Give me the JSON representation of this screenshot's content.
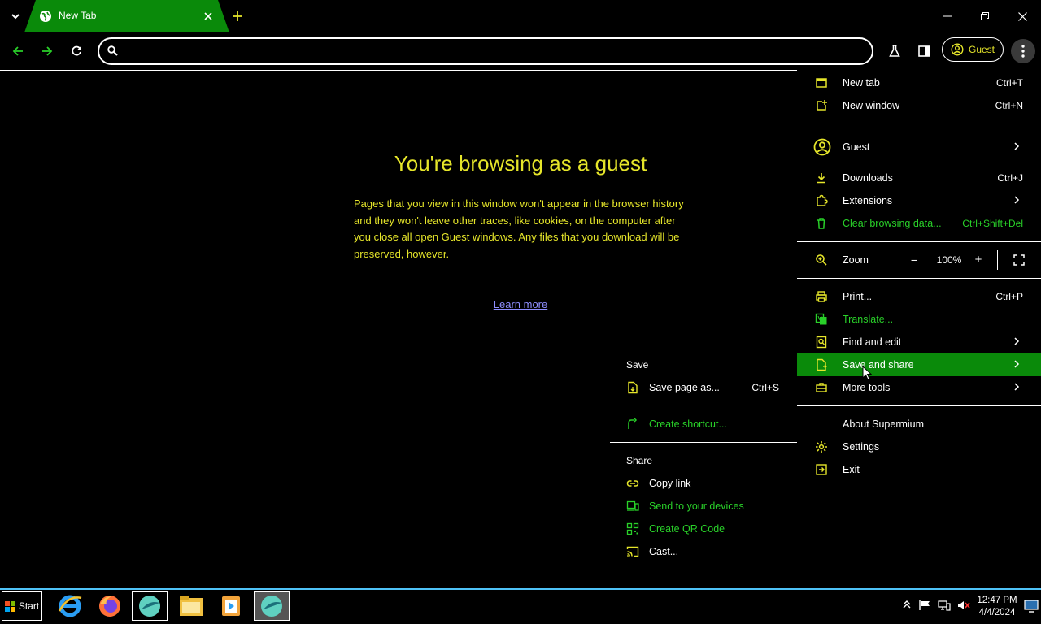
{
  "browser": {
    "tab_title": "New Tab",
    "guest_label": "Guest",
    "omnibox_value": ""
  },
  "page": {
    "title": "You're browsing as a guest",
    "body": "Pages that you view in this window won't appear in the browser history and they won't leave other traces, like cookies, on the computer after you close all open Guest windows. Any files that you download will be preserved, however.",
    "learn_more": "Learn more"
  },
  "menu": {
    "new_tab": {
      "label": "New tab",
      "shortcut": "Ctrl+T"
    },
    "new_window": {
      "label": "New window",
      "shortcut": "Ctrl+N"
    },
    "guest": {
      "label": "Guest"
    },
    "downloads": {
      "label": "Downloads",
      "shortcut": "Ctrl+J"
    },
    "extensions": {
      "label": "Extensions"
    },
    "clear_data": {
      "label": "Clear browsing data...",
      "shortcut": "Ctrl+Shift+Del"
    },
    "zoom": {
      "label": "Zoom",
      "minus": "−",
      "value": "100%",
      "plus": "+"
    },
    "print": {
      "label": "Print...",
      "shortcut": "Ctrl+P"
    },
    "translate": {
      "label": "Translate..."
    },
    "find_edit": {
      "label": "Find and edit"
    },
    "save_share": {
      "label": "Save and share"
    },
    "more_tools": {
      "label": "More tools"
    },
    "about": {
      "label": "About Supermium"
    },
    "settings": {
      "label": "Settings"
    },
    "exit": {
      "label": "Exit"
    }
  },
  "submenu": {
    "save_header": "Save",
    "save_page": {
      "label": "Save page as...",
      "shortcut": "Ctrl+S"
    },
    "create_shortcut": {
      "label": "Create shortcut..."
    },
    "share_header": "Share",
    "copy_link": {
      "label": "Copy link"
    },
    "send_devices": {
      "label": "Send to your devices"
    },
    "qr_code": {
      "label": "Create QR Code"
    },
    "cast": {
      "label": "Cast..."
    }
  },
  "taskbar": {
    "start_label": "Start",
    "time": "12:47 PM",
    "date": "4/4/2024"
  },
  "colors": {
    "accent_green": "#0a8a0a",
    "text_yellow": "#e6e62a",
    "text_green": "#29d029",
    "link": "#8e8eff"
  }
}
